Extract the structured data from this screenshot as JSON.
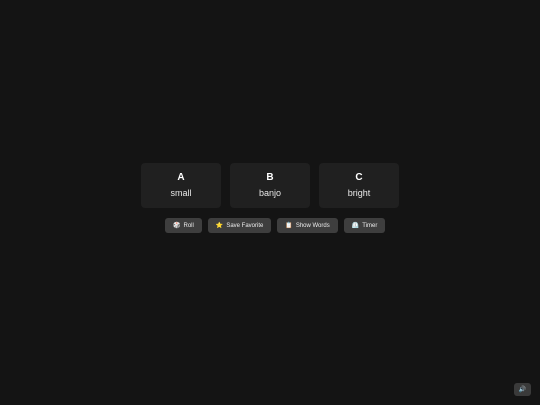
{
  "cards": [
    {
      "letter": "A",
      "word": "small"
    },
    {
      "letter": "B",
      "word": "banjo"
    },
    {
      "letter": "C",
      "word": "bright"
    }
  ],
  "actions": {
    "roll": {
      "icon": "🎲",
      "label": "Roll"
    },
    "save_favorite": {
      "icon": "⭐",
      "label": "Save Favorite"
    },
    "show_words": {
      "icon": "📋",
      "label": "Show Words"
    },
    "timer": {
      "icon": "⏲️",
      "label": "Timer"
    }
  },
  "sound": {
    "icon": "🔊"
  }
}
